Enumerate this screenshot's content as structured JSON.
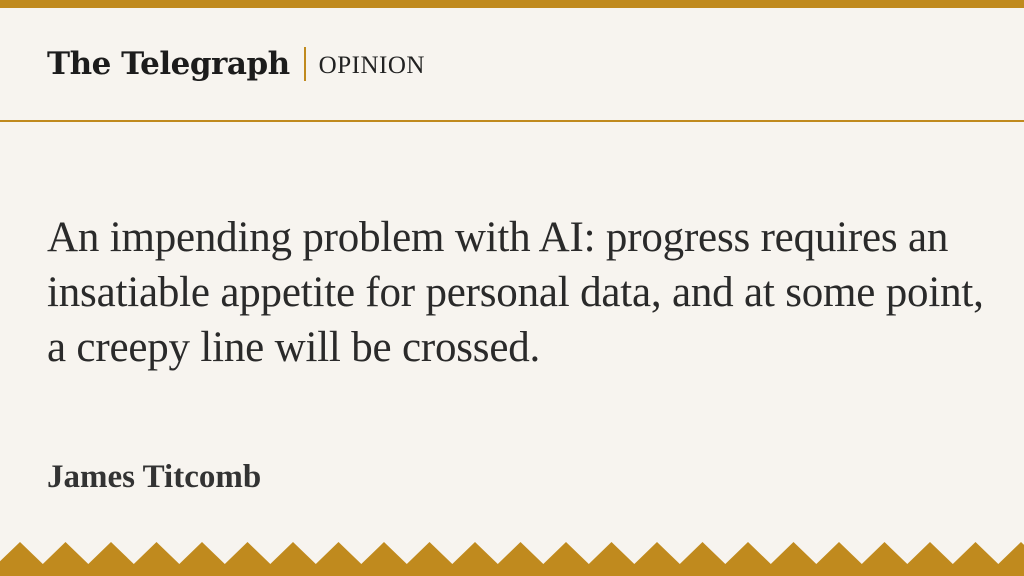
{
  "brand": {
    "name": "The Telegraph",
    "section": "OPINION",
    "accent_color": "#c08a1e",
    "background_color": "#f7f4ef"
  },
  "article": {
    "headline": "An impending problem with AI: progress requires an insatiable appetite for personal data, and at some point, a creepy line will be crossed.",
    "author": "James Titcomb"
  }
}
